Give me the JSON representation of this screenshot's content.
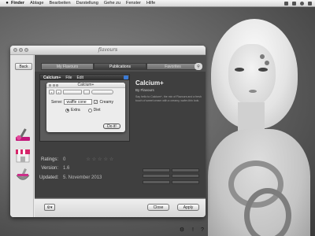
{
  "menubar": {
    "app": "Finder",
    "items": [
      "Ablage",
      "Bearbeiten",
      "Darstellung",
      "Gehe zu",
      "Fenster",
      "Hilfe"
    ]
  },
  "window": {
    "title": "flavours",
    "back_label": "Back",
    "tabs": [
      "My Flavours",
      "Publications",
      "Favorites"
    ],
    "active_tab": "Publications"
  },
  "preview": {
    "menubar": {
      "app": "Calcium+",
      "items": [
        "File",
        "Edit"
      ]
    },
    "dialog": {
      "title": "Calcium+",
      "serve_label": "Serve:",
      "serve_value": "waffle cone",
      "creamy_label": "Creamy",
      "creamy_checked": true,
      "extra_label": "Extra",
      "extra_selected": true,
      "diet_label": "Diet",
      "ok_label": "Do it!"
    }
  },
  "publication": {
    "name": "Calcium+",
    "author": "By Flavours",
    "description": "Say hello to Calcium+, the mix of Flavours and a fresh touch of sweet cream with a creamy, wafer-thin look.",
    "ratings_label": "Ratings:",
    "ratings_value": "0",
    "version_label": "Version:",
    "version_value": "1.6",
    "updated_label": "Updated:",
    "updated_value": "5. November 2013"
  },
  "bottom": {
    "close_label": "Close",
    "apply_label": "Apply"
  },
  "footer": {
    "gear_icon": "gear-icon",
    "info_label": "!",
    "help_label": "?"
  },
  "colors": {
    "accent": "#3b7bd6",
    "sidebar_brush": "#c2167a",
    "store_stripes": "#d6266a"
  }
}
